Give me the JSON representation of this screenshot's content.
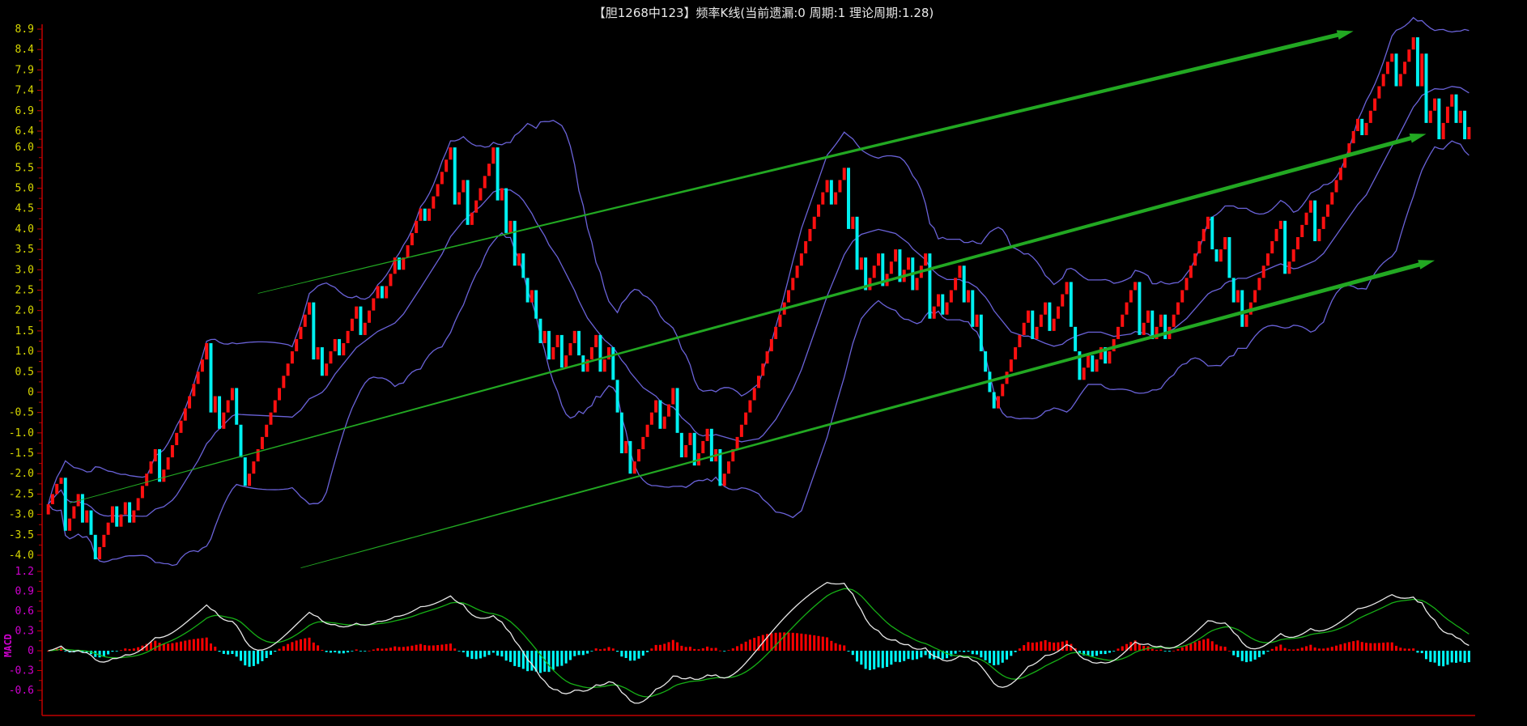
{
  "chart_data": {
    "type": "candlestick",
    "title": "【胆1268中123】频率K线(当前遗漏:0 周期:1 理论周期:1.28)",
    "price_axis": {
      "ylim": [
        -4.0,
        8.9
      ],
      "tick_labels": [
        "8.9",
        "8.4",
        "7.9",
        "7.4",
        "6.9",
        "6.4",
        "6.0",
        "5.5",
        "5.0",
        "4.5",
        "4.0",
        "3.5",
        "3.0",
        "2.5",
        "2.0",
        "1.5",
        "1.0",
        "0.5",
        "0",
        "-0.5",
        "-1.0",
        "-1.5",
        "-2.0",
        "-2.5",
        "-3.0",
        "-3.5",
        "-4.0"
      ],
      "tick_values": [
        8.9,
        8.4,
        7.9,
        7.4,
        6.9,
        6.4,
        6.0,
        5.5,
        5.0,
        4.5,
        4.0,
        3.5,
        3.0,
        2.5,
        2.0,
        1.5,
        1.0,
        0.5,
        0,
        -0.5,
        -1.0,
        -1.5,
        -2.0,
        -2.5,
        -3.0,
        -3.5,
        -4.0
      ]
    },
    "macd_axis": {
      "label": "MACD",
      "ylim": [
        -0.8,
        1.2
      ],
      "tick_labels": [
        "1.2",
        "0.9",
        "0.6",
        "0.3",
        "0",
        "-0.3",
        "-0.6"
      ],
      "tick_values": [
        1.2,
        0.9,
        0.6,
        0.3,
        0,
        -0.3,
        -0.6
      ]
    },
    "start_value": -3.0,
    "closes": [
      -2.75,
      -2.5,
      -2.25,
      -2.1,
      -3.4,
      -3.1,
      -2.8,
      -2.5,
      -3.2,
      -2.9,
      -3.5,
      -4.1,
      -3.8,
      -3.5,
      -3.2,
      -2.8,
      -3.3,
      -3.0,
      -2.7,
      -3.2,
      -2.9,
      -2.6,
      -2.3,
      -2.0,
      -1.7,
      -1.4,
      -2.2,
      -1.9,
      -1.6,
      -1.3,
      -1.0,
      -0.7,
      -0.4,
      -0.1,
      0.2,
      0.5,
      0.8,
      1.2,
      -0.5,
      -0.1,
      -0.9,
      -0.5,
      -0.2,
      0.1,
      -0.8,
      -1.6,
      -2.3,
      -2.0,
      -1.7,
      -1.4,
      -1.1,
      -0.8,
      -0.5,
      -0.2,
      0.1,
      0.4,
      0.7,
      1.0,
      1.3,
      1.6,
      1.9,
      2.2,
      0.8,
      1.1,
      0.4,
      0.7,
      1.0,
      1.3,
      0.9,
      1.2,
      1.5,
      1.8,
      2.1,
      1.4,
      1.7,
      2.0,
      2.3,
      2.6,
      2.3,
      2.6,
      2.9,
      3.3,
      3.0,
      3.3,
      3.6,
      3.9,
      4.2,
      4.5,
      4.2,
      4.5,
      4.8,
      5.1,
      5.4,
      5.7,
      6.0,
      4.6,
      4.9,
      5.2,
      4.1,
      4.4,
      4.7,
      5.0,
      5.3,
      5.6,
      6.0,
      4.7,
      5.0,
      3.9,
      4.2,
      3.1,
      3.4,
      2.8,
      2.2,
      2.5,
      1.8,
      1.2,
      1.5,
      0.8,
      1.1,
      1.4,
      0.6,
      0.9,
      1.2,
      1.5,
      0.9,
      0.5,
      0.8,
      1.1,
      1.4,
      0.5,
      0.8,
      1.1,
      0.3,
      -0.5,
      -1.5,
      -1.2,
      -2.0,
      -1.7,
      -1.4,
      -1.1,
      -0.8,
      -0.5,
      -0.2,
      -0.9,
      -0.6,
      -0.3,
      0.1,
      -1.0,
      -1.6,
      -1.3,
      -1.0,
      -1.8,
      -1.5,
      -1.2,
      -0.9,
      -1.7,
      -1.4,
      -2.3,
      -2.0,
      -1.7,
      -1.4,
      -1.1,
      -0.8,
      -0.5,
      -0.2,
      0.1,
      0.4,
      0.7,
      1.0,
      1.3,
      1.6,
      1.9,
      2.2,
      2.5,
      2.8,
      3.1,
      3.4,
      3.7,
      4.0,
      4.3,
      4.6,
      4.9,
      5.2,
      4.6,
      4.9,
      5.2,
      5.5,
      4.0,
      4.3,
      3.0,
      3.3,
      2.5,
      2.8,
      3.1,
      3.4,
      2.6,
      2.9,
      3.2,
      3.5,
      2.7,
      3.0,
      3.3,
      2.5,
      2.8,
      3.1,
      3.4,
      1.8,
      2.1,
      2.4,
      1.9,
      2.2,
      2.5,
      2.8,
      3.1,
      2.2,
      2.5,
      1.6,
      1.9,
      1.0,
      0.5,
      0.0,
      -0.4,
      -0.1,
      0.2,
      0.5,
      0.8,
      1.1,
      1.4,
      1.7,
      2.0,
      1.3,
      1.6,
      1.9,
      2.2,
      1.5,
      1.8,
      2.1,
      2.4,
      2.7,
      1.6,
      1.0,
      0.3,
      0.6,
      0.9,
      0.5,
      0.8,
      1.1,
      0.7,
      1.0,
      1.3,
      1.6,
      1.9,
      2.2,
      2.5,
      2.7,
      1.4,
      1.7,
      2.0,
      1.3,
      1.6,
      1.9,
      1.3,
      1.6,
      1.9,
      2.2,
      2.5,
      2.8,
      3.1,
      3.4,
      3.7,
      4.0,
      4.3,
      3.5,
      3.2,
      3.5,
      3.8,
      2.8,
      2.2,
      2.5,
      1.6,
      1.9,
      2.2,
      2.5,
      2.8,
      3.1,
      3.4,
      3.7,
      4.0,
      4.2,
      2.9,
      3.2,
      3.5,
      3.8,
      4.1,
      4.4,
      4.7,
      3.7,
      4.0,
      4.3,
      4.6,
      4.9,
      5.2,
      5.5,
      5.8,
      6.1,
      6.4,
      6.7,
      6.3,
      6.6,
      6.9,
      7.2,
      7.5,
      7.8,
      8.1,
      8.3,
      7.5,
      7.8,
      8.1,
      8.4,
      8.7,
      7.5,
      8.3,
      6.6,
      6.9,
      7.2,
      6.2,
      6.6,
      7.0,
      7.3,
      6.6,
      6.9,
      6.2,
      6.5
    ],
    "indicators": {
      "bollinger": {
        "period": 20,
        "k": 2,
        "color": "#6a62d8"
      },
      "macd": {
        "fast": 12,
        "slow": 26,
        "signal": 9,
        "dif_color": "#e8e8e8",
        "dea_color": "#16b016",
        "up_color": "#ff0000",
        "down_color": "#00ffff"
      }
    },
    "trend_lines": [
      {
        "name": "upper",
        "from": [
          49,
          2.42
        ],
        "to": [
          305,
          8.85
        ]
      },
      {
        "name": "middle",
        "from": [
          5,
          -2.72
        ],
        "to": [
          322,
          6.33
        ]
      },
      {
        "name": "lower",
        "from": [
          59,
          -4.31
        ],
        "to": [
          324,
          3.23
        ]
      }
    ],
    "colors": {
      "up": "#ff1010",
      "down": "#00f0f0",
      "price_tick": "#d8d800",
      "macd_tick": "#d000d0",
      "axis": "#c00000",
      "trend": "#22a822"
    }
  }
}
